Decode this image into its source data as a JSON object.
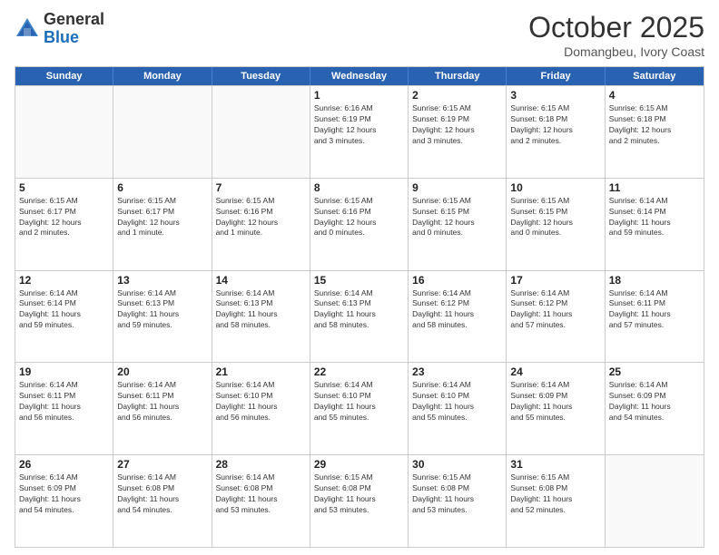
{
  "header": {
    "logo_general": "General",
    "logo_blue": "Blue",
    "month_title": "October 2025",
    "subtitle": "Domangbeu, Ivory Coast"
  },
  "calendar": {
    "days_of_week": [
      "Sunday",
      "Monday",
      "Tuesday",
      "Wednesday",
      "Thursday",
      "Friday",
      "Saturday"
    ],
    "rows": [
      [
        {
          "day": "",
          "info": ""
        },
        {
          "day": "",
          "info": ""
        },
        {
          "day": "",
          "info": ""
        },
        {
          "day": "1",
          "info": "Sunrise: 6:16 AM\nSunset: 6:19 PM\nDaylight: 12 hours\nand 3 minutes."
        },
        {
          "day": "2",
          "info": "Sunrise: 6:15 AM\nSunset: 6:19 PM\nDaylight: 12 hours\nand 3 minutes."
        },
        {
          "day": "3",
          "info": "Sunrise: 6:15 AM\nSunset: 6:18 PM\nDaylight: 12 hours\nand 2 minutes."
        },
        {
          "day": "4",
          "info": "Sunrise: 6:15 AM\nSunset: 6:18 PM\nDaylight: 12 hours\nand 2 minutes."
        }
      ],
      [
        {
          "day": "5",
          "info": "Sunrise: 6:15 AM\nSunset: 6:17 PM\nDaylight: 12 hours\nand 2 minutes."
        },
        {
          "day": "6",
          "info": "Sunrise: 6:15 AM\nSunset: 6:17 PM\nDaylight: 12 hours\nand 1 minute."
        },
        {
          "day": "7",
          "info": "Sunrise: 6:15 AM\nSunset: 6:16 PM\nDaylight: 12 hours\nand 1 minute."
        },
        {
          "day": "8",
          "info": "Sunrise: 6:15 AM\nSunset: 6:16 PM\nDaylight: 12 hours\nand 0 minutes."
        },
        {
          "day": "9",
          "info": "Sunrise: 6:15 AM\nSunset: 6:15 PM\nDaylight: 12 hours\nand 0 minutes."
        },
        {
          "day": "10",
          "info": "Sunrise: 6:15 AM\nSunset: 6:15 PM\nDaylight: 12 hours\nand 0 minutes."
        },
        {
          "day": "11",
          "info": "Sunrise: 6:14 AM\nSunset: 6:14 PM\nDaylight: 11 hours\nand 59 minutes."
        }
      ],
      [
        {
          "day": "12",
          "info": "Sunrise: 6:14 AM\nSunset: 6:14 PM\nDaylight: 11 hours\nand 59 minutes."
        },
        {
          "day": "13",
          "info": "Sunrise: 6:14 AM\nSunset: 6:13 PM\nDaylight: 11 hours\nand 59 minutes."
        },
        {
          "day": "14",
          "info": "Sunrise: 6:14 AM\nSunset: 6:13 PM\nDaylight: 11 hours\nand 58 minutes."
        },
        {
          "day": "15",
          "info": "Sunrise: 6:14 AM\nSunset: 6:13 PM\nDaylight: 11 hours\nand 58 minutes."
        },
        {
          "day": "16",
          "info": "Sunrise: 6:14 AM\nSunset: 6:12 PM\nDaylight: 11 hours\nand 58 minutes."
        },
        {
          "day": "17",
          "info": "Sunrise: 6:14 AM\nSunset: 6:12 PM\nDaylight: 11 hours\nand 57 minutes."
        },
        {
          "day": "18",
          "info": "Sunrise: 6:14 AM\nSunset: 6:11 PM\nDaylight: 11 hours\nand 57 minutes."
        }
      ],
      [
        {
          "day": "19",
          "info": "Sunrise: 6:14 AM\nSunset: 6:11 PM\nDaylight: 11 hours\nand 56 minutes."
        },
        {
          "day": "20",
          "info": "Sunrise: 6:14 AM\nSunset: 6:11 PM\nDaylight: 11 hours\nand 56 minutes."
        },
        {
          "day": "21",
          "info": "Sunrise: 6:14 AM\nSunset: 6:10 PM\nDaylight: 11 hours\nand 56 minutes."
        },
        {
          "day": "22",
          "info": "Sunrise: 6:14 AM\nSunset: 6:10 PM\nDaylight: 11 hours\nand 55 minutes."
        },
        {
          "day": "23",
          "info": "Sunrise: 6:14 AM\nSunset: 6:10 PM\nDaylight: 11 hours\nand 55 minutes."
        },
        {
          "day": "24",
          "info": "Sunrise: 6:14 AM\nSunset: 6:09 PM\nDaylight: 11 hours\nand 55 minutes."
        },
        {
          "day": "25",
          "info": "Sunrise: 6:14 AM\nSunset: 6:09 PM\nDaylight: 11 hours\nand 54 minutes."
        }
      ],
      [
        {
          "day": "26",
          "info": "Sunrise: 6:14 AM\nSunset: 6:09 PM\nDaylight: 11 hours\nand 54 minutes."
        },
        {
          "day": "27",
          "info": "Sunrise: 6:14 AM\nSunset: 6:08 PM\nDaylight: 11 hours\nand 54 minutes."
        },
        {
          "day": "28",
          "info": "Sunrise: 6:14 AM\nSunset: 6:08 PM\nDaylight: 11 hours\nand 53 minutes."
        },
        {
          "day": "29",
          "info": "Sunrise: 6:15 AM\nSunset: 6:08 PM\nDaylight: 11 hours\nand 53 minutes."
        },
        {
          "day": "30",
          "info": "Sunrise: 6:15 AM\nSunset: 6:08 PM\nDaylight: 11 hours\nand 53 minutes."
        },
        {
          "day": "31",
          "info": "Sunrise: 6:15 AM\nSunset: 6:08 PM\nDaylight: 11 hours\nand 52 minutes."
        },
        {
          "day": "",
          "info": ""
        }
      ]
    ]
  }
}
